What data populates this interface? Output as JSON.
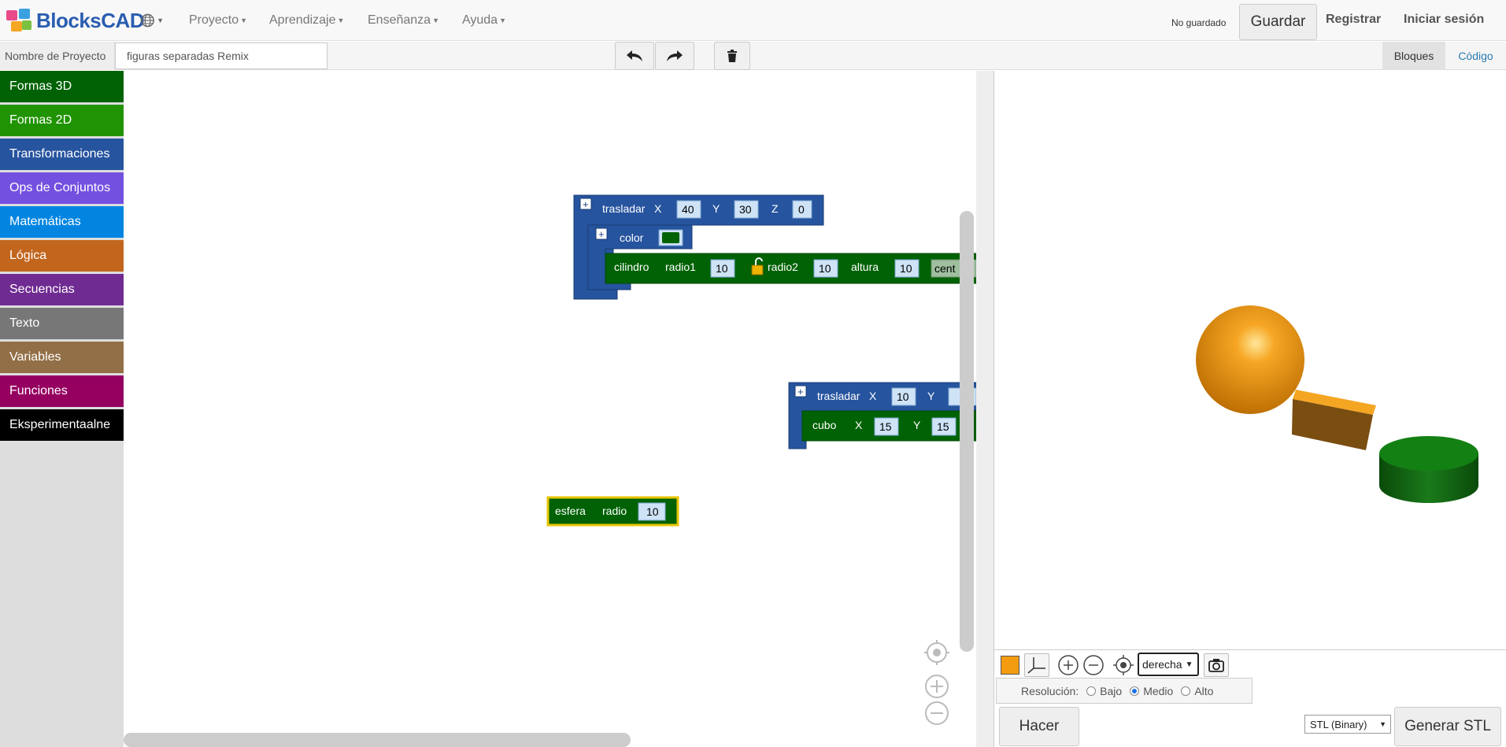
{
  "navbar": {
    "brand": "BlocksCAD",
    "menus": [
      "Proyecto",
      "Aprendizaje",
      "Enseñanza",
      "Ayuda"
    ],
    "save_status": "No guardado",
    "save_button": "Guardar",
    "register": "Registrar",
    "login": "Iniciar sesión"
  },
  "subbar": {
    "project_label": "Nombre de Proyecto",
    "project_name": "figuras separadas Remix",
    "tab_blocks": "Bloques",
    "tab_code": "Código"
  },
  "toolbox": {
    "categories": [
      {
        "label": "Formas 3D",
        "color": "#006205"
      },
      {
        "label": "Formas 2D",
        "color": "#209303"
      },
      {
        "label": "Transformaciones",
        "color": "#26549e"
      },
      {
        "label": "Ops de Conjuntos",
        "color": "#7450e0"
      },
      {
        "label": "Matemáticas",
        "color": "#0185e1"
      },
      {
        "label": "Lógica",
        "color": "#c2661e"
      },
      {
        "label": "Secuencias",
        "color": "#6f2b91"
      },
      {
        "label": "Texto",
        "color": "#777777"
      },
      {
        "label": "Variables",
        "color": "#926f46"
      },
      {
        "label": "Funciones",
        "color": "#950060"
      },
      {
        "label": "Eksperimentaalne",
        "color": "#000000"
      }
    ]
  },
  "blocks": {
    "translate1": {
      "label": "trasladar",
      "x_label": "X",
      "x": "40",
      "y_label": "Y",
      "y": "30",
      "z_label": "Z",
      "z": "0"
    },
    "color": {
      "label": "color",
      "swatch": "#006205"
    },
    "cylinder": {
      "label": "cilindro",
      "r1_label": "radio1",
      "r1": "10",
      "r2_label": "radio2",
      "r2": "10",
      "h_label": "altura",
      "h": "10",
      "center": "cent"
    },
    "translate2": {
      "label": "trasladar",
      "x_label": "X",
      "x": "10",
      "y_label": "Y"
    },
    "cube": {
      "label": "cubo",
      "x_label": "X",
      "x": "15",
      "y_label": "Y",
      "y": "15"
    },
    "sphere": {
      "label": "esfera",
      "r_label": "radio",
      "r": "10"
    }
  },
  "viewer": {
    "view_select": "derecha",
    "resolution_label": "Resolución:",
    "res_low": "Bajo",
    "res_mid": "Medio",
    "res_high": "Alto",
    "res_selected": "Medio",
    "make_button": "Hacer",
    "stl_select": "STL (Binary)",
    "generate_button": "Generar STL",
    "color_swatch": "#f39c12"
  },
  "colors": {
    "transform_blue": "#26549e",
    "shape_green": "#006205",
    "accent_link": "#2a7ab0"
  }
}
